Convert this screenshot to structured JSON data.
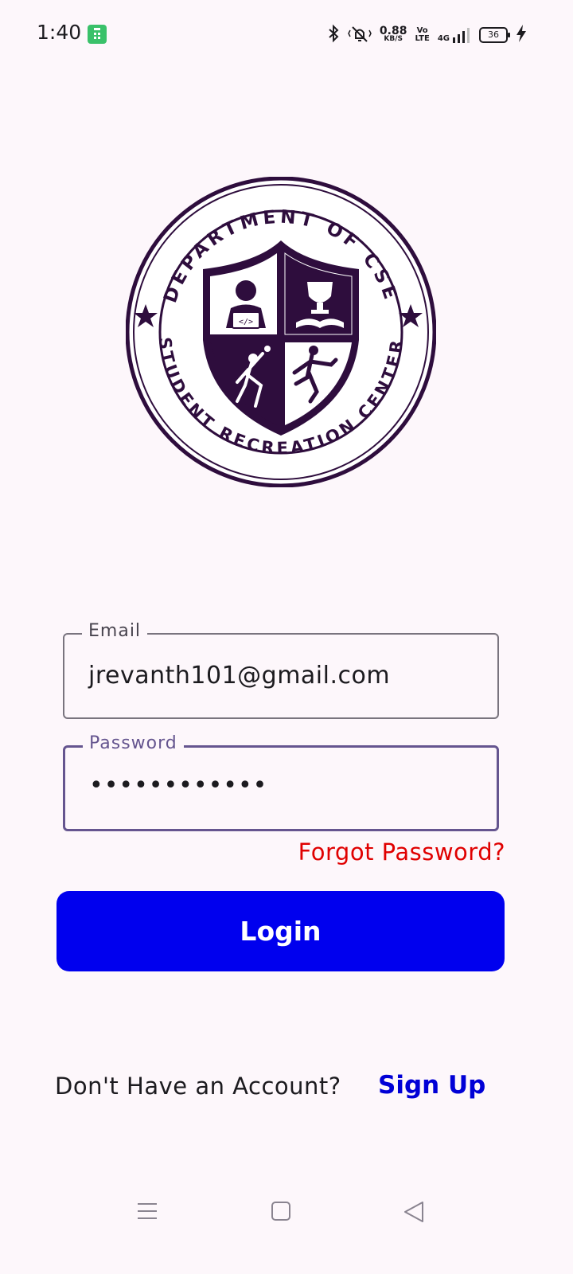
{
  "status_bar": {
    "time": "1:40",
    "net_speed": "0.88",
    "net_speed_unit": "KB/S",
    "volte": "Vo\nLTE",
    "network": "4G",
    "battery": "36",
    "icons": [
      "app-notification-icon",
      "bluetooth-icon",
      "vibrate-icon",
      "signal-icon",
      "battery-icon",
      "charging-icon"
    ]
  },
  "logo": {
    "top_text": "DEPARTMENT OF CSE",
    "bottom_text": "STUDENT RECREATION CENTER",
    "color": "#2e0d3d"
  },
  "form": {
    "email": {
      "label": "Email",
      "value": "jrevanth101@gmail.com"
    },
    "password": {
      "label": "Password",
      "value": "••••••••••••"
    },
    "forgot_label": "Forgot Password?",
    "login_label": "Login"
  },
  "signup": {
    "prompt": "Don't Have an Account?",
    "link_label": "Sign Up"
  },
  "colors": {
    "background": "#fdf7fb",
    "primary_button": "#0000ee",
    "forgot_link": "#e00000",
    "signup_link": "#0000d6",
    "focus_outline": "#65558f"
  },
  "nav_bar": {
    "icons": [
      "menu-icon",
      "home-icon",
      "back-icon"
    ]
  }
}
